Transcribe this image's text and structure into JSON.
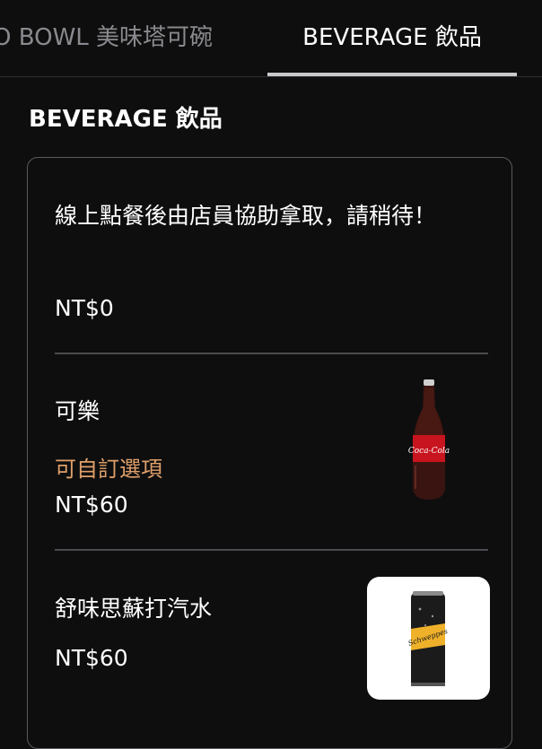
{
  "tabs": [
    {
      "label": "O BOWL 美味塔可碗",
      "active": false
    },
    {
      "label": "BEVERAGE 飲品",
      "active": true
    }
  ],
  "section": {
    "title": "BEVERAGE 飲品"
  },
  "items": [
    {
      "name": "線上點餐後由店員協助拿取，請稍待！",
      "price": "NT$0"
    },
    {
      "name": "可樂",
      "option": "可自訂選項",
      "price": "NT$60",
      "image": "coca-cola-bottle"
    },
    {
      "name": "舒味思蘇打汽水",
      "price": "NT$60",
      "image": "schweppes-can"
    }
  ],
  "colors": {
    "background": "#0e0e0f",
    "option_text": "#e0a06a",
    "tab_inactive": "#8a8a8e"
  }
}
